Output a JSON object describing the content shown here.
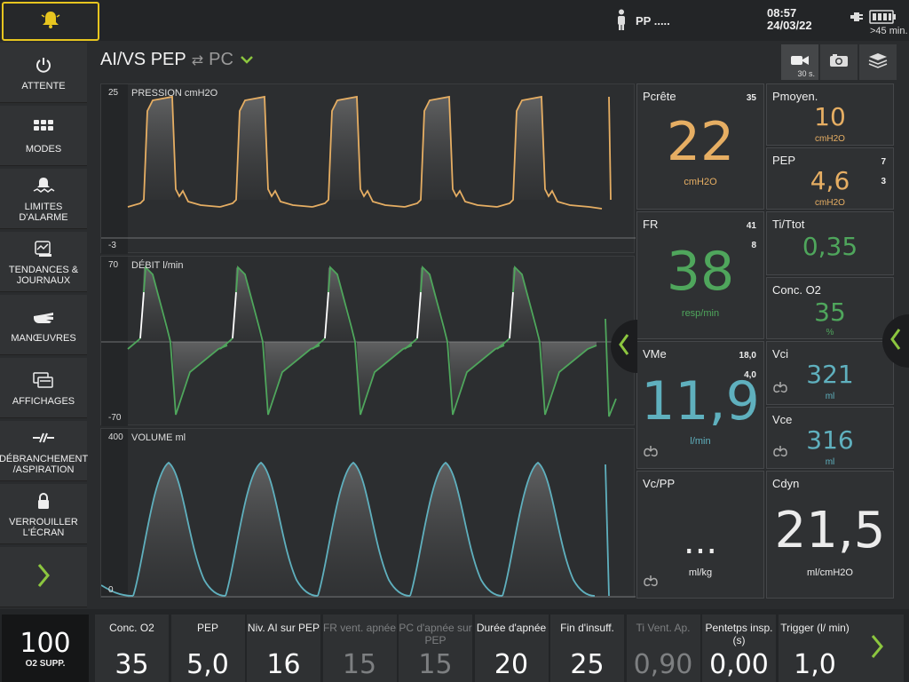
{
  "topbar": {
    "patient_label": "PP .....",
    "time": "08:57",
    "date": "24/03/22",
    "battery_text": ">45 min."
  },
  "menu": {
    "items": [
      {
        "label": "ATTENTE",
        "icon": "power-icon"
      },
      {
        "label": "MODES",
        "icon": "grid-icon"
      },
      {
        "label": "LIMITES D'ALARME",
        "icon": "alarm-limits-icon"
      },
      {
        "label": "TENDANCES & JOURNAUX",
        "icon": "trends-icon"
      },
      {
        "label": "MANŒUVRES",
        "icon": "hand-icon"
      },
      {
        "label": "AFFICHAGES",
        "icon": "displays-icon"
      },
      {
        "label": "DÉBRANCHEMENT /ASPIRATION",
        "icon": "disconnect-icon"
      },
      {
        "label": "VERROUILLER L'ÉCRAN",
        "icon": "lock-icon"
      }
    ]
  },
  "header": {
    "mode": "AI/VS PEP",
    "alt_mode": "PC",
    "record_30s_label": "30 s."
  },
  "waves": {
    "pressure": {
      "label": "PRESSION cmH2O",
      "max": "25",
      "min": "-3",
      "color": "#e6ae63"
    },
    "flow": {
      "label": "DÉBIT l/min",
      "max": "70",
      "min": "-70",
      "color": "#4fa65c"
    },
    "volume": {
      "label": "VOLUME ml",
      "max": "400",
      "min": "0",
      "color": "#5fb0be"
    }
  },
  "tiles": {
    "pcrete": {
      "label": "Pcrête",
      "lim_high": "35",
      "value": "22",
      "unit": "cmH2O"
    },
    "pmoyen": {
      "label": "Pmoyen.",
      "value": "10",
      "unit": "cmH2O"
    },
    "pep": {
      "label": "PEP",
      "lim_high": "7",
      "lim_low": "3",
      "value": "4,6",
      "unit": "cmH2O"
    },
    "fr": {
      "label": "FR",
      "lim_high": "41",
      "lim_low": "8",
      "value": "38",
      "unit": "resp/min"
    },
    "titot": {
      "label": "Ti/Ttot",
      "value": "0,35"
    },
    "conco2": {
      "label": "Conc. O2",
      "value": "35",
      "unit": "%"
    },
    "vme": {
      "label": "VMe",
      "lim_high": "18,0",
      "lim_low": "4,0",
      "value": "11,9",
      "unit": "l/min"
    },
    "vci": {
      "label": "Vci",
      "value": "321",
      "unit": "ml"
    },
    "vce": {
      "label": "Vce",
      "value": "316",
      "unit": "ml"
    },
    "vcpp": {
      "label": "Vc/PP",
      "value": "...",
      "unit": "ml/kg"
    },
    "cdyn": {
      "label": "Cdyn",
      "value": "21,5",
      "unit": "ml/cmH2O"
    }
  },
  "bottom": {
    "o2": {
      "value": "100",
      "label": "O2 SUPP."
    },
    "settings": [
      {
        "label": "Conc. O2",
        "value": "35",
        "dim": false
      },
      {
        "label": "PEP",
        "value": "5,0",
        "dim": false
      },
      {
        "label": "Niv. AI sur PEP",
        "value": "16",
        "dim": false
      },
      {
        "label": "FR vent. apnée",
        "value": "15",
        "dim": true
      },
      {
        "label": "PC d'apnée sur PEP",
        "value": "15",
        "dim": true
      },
      {
        "label": "Durée d'apnée",
        "value": "20",
        "dim": false
      },
      {
        "label": "Fin d'insuff.",
        "value": "25",
        "dim": false
      },
      {
        "label": "Ti Vent. Ap.",
        "value": "0,90",
        "dim": true
      },
      {
        "label": "Pentetps insp. (s)",
        "value": "0,00",
        "dim": false
      },
      {
        "label": "Trigger (l/ min)",
        "value": "1,0",
        "dim": false
      }
    ]
  },
  "colors": {
    "alarm_border": "#e7c51f",
    "chevron": "#8cc63f"
  }
}
